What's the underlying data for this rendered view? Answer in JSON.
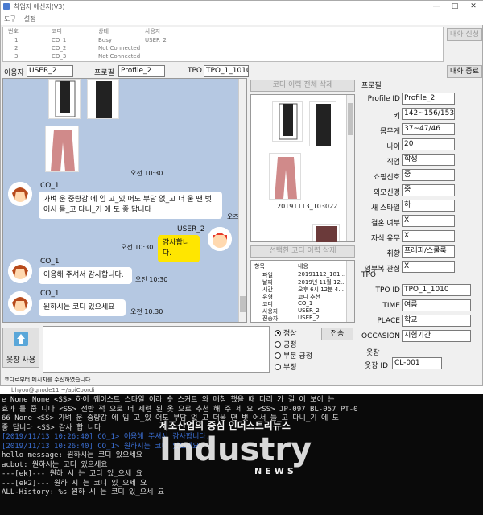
{
  "window": {
    "title": "착업자 에신지(V3)",
    "minimize": "—",
    "maximize": "□",
    "close": "✕"
  },
  "menu": [
    "도구",
    "설정"
  ],
  "user_list": {
    "headers": [
      "번호",
      "코디",
      "상태",
      "사용자"
    ],
    "rows": [
      [
        "1",
        "CO_1",
        "Busy",
        "USER_2"
      ],
      [
        "2",
        "CO_2",
        "Not Connected",
        ""
      ],
      [
        "3",
        "CO_3",
        "Not Connected",
        ""
      ]
    ]
  },
  "buttons": {
    "chat_request": "대화 신청",
    "end_chat": "대화 종료",
    "delete_all": "코디 이력 전체 삭제",
    "delete_selected": "선택한 코디 이력 삭제",
    "send": "전송",
    "use_outfit": "옷장 사용"
  },
  "header": {
    "user_label": "이용자",
    "user_value": "USER_2",
    "profile_label": "프로필",
    "profile_value": "Profile_2",
    "tpo_label": "TPO",
    "tpo_value": "TPO_1_1010"
  },
  "chat": {
    "messages": [
      {
        "time": "오전 10:30"
      },
      {
        "sender": "CO_1",
        "text": "가벼 운 중량감 에 입 고_있 어도 부담 없_고 더 울 땐 벗\n어서 들_고 다니_기 에 도 좋 답니다"
      },
      {
        "sender": "USER_2",
        "text": "감사합니다.",
        "time": "오전 10:30"
      },
      {
        "sender": "CO_1",
        "text": "이용해 주셔서 감사합니다.",
        "time": "오전 10:30"
      },
      {
        "sender": "CO_1",
        "text": "원하시는 코디 있으세요",
        "time": "오전 10:30"
      }
    ],
    "edge_label": "오즈"
  },
  "history": {
    "item_caption": "20191113_103022",
    "table_headers": [
      "항목",
      "내용"
    ],
    "table_rows": [
      [
        "파일",
        "20191112_181..."
      ],
      [
        "날짜",
        "2019년 11월 12..."
      ],
      [
        "시간",
        "오후 6시 12분 4..."
      ],
      [
        "유형",
        "코디 추천"
      ],
      [
        "코디",
        "CO_1"
      ],
      [
        "사용자",
        "USER_2"
      ],
      [
        "전송자",
        "USER_2"
      ]
    ]
  },
  "profile": {
    "title": "프로필",
    "fields": [
      {
        "label": "Profile ID",
        "value": "Profile_2"
      },
      {
        "label": "키",
        "value": "142~156/153"
      },
      {
        "label": "몸무게",
        "value": "37~47/46"
      },
      {
        "label": "나이",
        "value": "20"
      },
      {
        "label": "직업",
        "value": "학생"
      },
      {
        "label": "쇼핑선호",
        "value": "중"
      },
      {
        "label": "외모신경",
        "value": "중"
      },
      {
        "label": "새 스타일",
        "value": "하"
      },
      {
        "label": "결혼 여부",
        "value": "X"
      },
      {
        "label": "자식 유무",
        "value": "X"
      },
      {
        "label": "취향",
        "value": "프레피/스쿨룩"
      },
      {
        "label": "임부복 관심",
        "value": "X"
      }
    ]
  },
  "tpo": {
    "title": "TPO",
    "fields": [
      {
        "label": "TPO ID",
        "value": "TPO_1_1010"
      },
      {
        "label": "TIME",
        "value": "여름"
      },
      {
        "label": "PLACE",
        "value": "학교"
      },
      {
        "label": "OCCASION",
        "value": "시험기간"
      }
    ]
  },
  "wardrobe": {
    "title": "옷장",
    "label": "옷장 ID",
    "value": "CL-001"
  },
  "radio": {
    "options": [
      "정상",
      "긍정",
      "부분 긍정",
      "부정"
    ],
    "selected": 0
  },
  "status_bar": "코디로부터 메시지를 수신하였습니다.",
  "terminal": {
    "title": "bhyoo@gnode11:~/apiCoordi",
    "lines": [
      "e None None <SS> 하이 웨이스트 스타일 이라 숏 스커트 와 매칭 했을 때 다리 가 길 어 보이 는",
      "효과 를 줍 니다 <SS> 전반 적 으로 더 세련 된 옷 으로 추천 해 주 세 요 <SS> JP-097 BL-057 PT-0",
      "66 None <SS> 가벼 운 중량감 에 입 고_있 어도 부담 없_고 더울 땐 벗 어서 들_고 다니_기 에 도",
      "좋 답니다 <SS> 감사_합 니다",
      "[2019/11/13 10:26:40] CO_1> 이용해 주셔서 감사합니다.",
      "[2019/11/13 10:26:40] CO_1> 원하시는 코디 있으세요",
      "hello message: 원하시는 코디 있으세요",
      "acbot: 원하시는 코디 있으세요",
      "---[ek]--- 원하 시 는 코디 있_으세 요",
      "---[ek2]--- 원하 시 는 코디 있_으세 요",
      "ALL-History: %s 원하 시 는 코디 있_으세 요"
    ],
    "blue_lines": [
      4,
      5
    ]
  },
  "watermark": {
    "line1": "제조산업의 중심 인더스트리뉴스",
    "line2": "Industry",
    "line3": "NEWS"
  }
}
